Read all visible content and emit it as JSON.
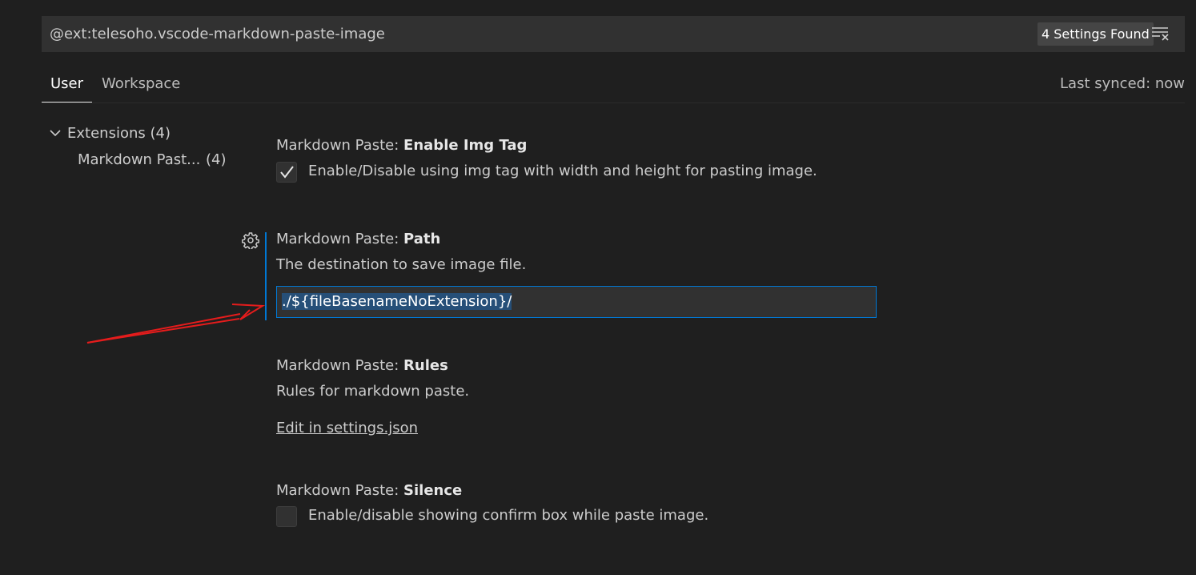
{
  "search": {
    "query": "@ext:telesoho.vscode-markdown-paste-image",
    "result_count": "4 Settings Found",
    "clear_icon": "clear-filter-icon"
  },
  "tabs": [
    {
      "label": "User",
      "active": true
    },
    {
      "label": "Workspace",
      "active": false
    }
  ],
  "sync_status": "Last synced: now",
  "toc": {
    "group_label": "Extensions (4)",
    "item_label": "Markdown Past...",
    "item_count": "(4)"
  },
  "settings": [
    {
      "category": "Markdown Paste: ",
      "key": "Enable Img Tag",
      "description": "Enable/Disable using img tag with width and height for pasting image.",
      "checked": true
    },
    {
      "category": "Markdown Paste: ",
      "key": "Path",
      "description": "The destination to save image file.",
      "value": "./${fileBasenameNoExtension}/"
    },
    {
      "category": "Markdown Paste: ",
      "key": "Rules",
      "description": "Rules for markdown paste.",
      "link": "Edit in settings.json"
    },
    {
      "category": "Markdown Paste: ",
      "key": "Silence",
      "description": "Enable/disable showing confirm box while paste image.",
      "checked": false
    }
  ],
  "colors": {
    "background": "#1f1f1f",
    "accent": "#0078d4",
    "selection": "#264f78",
    "annotation": "#e51c1c"
  }
}
